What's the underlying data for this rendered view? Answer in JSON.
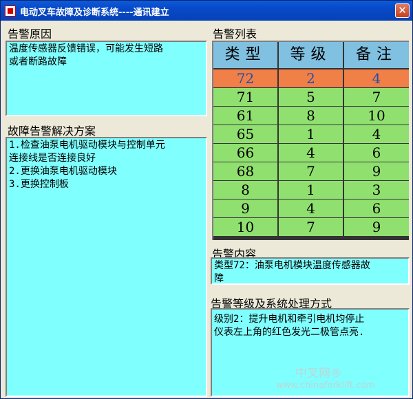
{
  "window": {
    "title": "电动叉车故障及诊断系统----通讯建立",
    "close_glyph": "✕"
  },
  "cause": {
    "label": "告警原因",
    "lines": [
      "温度传感器反馈错误，可能发生短路",
      "或者断路故障"
    ]
  },
  "solution": {
    "label": "故障告警解决方案",
    "lines": [
      "1.检查油泵电机驱动模块与控制单元",
      "连接线是否连接良好",
      "2.更换油泵电机驱动模块",
      "3.更换控制板"
    ]
  },
  "alarm_list": {
    "label": "告警列表",
    "columns": [
      "类型",
      "等级",
      "备注"
    ],
    "rows": [
      [
        "72",
        "2",
        "4"
      ],
      [
        "71",
        "5",
        "7"
      ],
      [
        "61",
        "8",
        "10"
      ],
      [
        "65",
        "1",
        "4"
      ],
      [
        "66",
        "4",
        "6"
      ],
      [
        "68",
        "7",
        "9"
      ],
      [
        "8",
        "1",
        "3"
      ],
      [
        "9",
        "4",
        "6"
      ],
      [
        "10",
        "7",
        "9"
      ]
    ],
    "selected_row": 0
  },
  "content": {
    "label": "告警内容",
    "lines": [
      "类型72：油泵电机模块温度传感器故",
      "障"
    ]
  },
  "level": {
    "label": "告警等级及系统处理方式",
    "lines": [
      "级别2：提升电机和牵引电机均停止",
      "仪表左上角的红色发光二极管点亮."
    ]
  },
  "watermark": {
    "top": "中叉网®",
    "bottom": "www.chinaforklift.com"
  },
  "colors": {
    "panel": "#80ffff",
    "row": "#90e070",
    "header": "#80c0e0",
    "selected": "#f08048"
  }
}
